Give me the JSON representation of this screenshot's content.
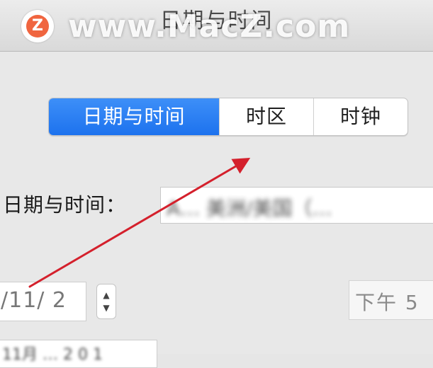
{
  "window": {
    "title": "日期与时间"
  },
  "watermark": {
    "logo_letter": "Z",
    "text": "www.MacZ.com"
  },
  "tabs": [
    {
      "label": "日期与时间",
      "active": true
    },
    {
      "label": "时区",
      "active": false
    },
    {
      "label": "时钟",
      "active": false
    }
  ],
  "form": {
    "date_time_label": "日期与时间：",
    "timezone_value": "A…  美洲/美国（…"
  },
  "date_input": {
    "value": "/11/ 2"
  },
  "time_input": {
    "value": "下午 5"
  },
  "calendar_header": {
    "value": "11月 … 2 0 1"
  },
  "annotation": {
    "arrow_color": "#d4202c"
  },
  "colors": {
    "accent": "#1d72ee",
    "watermark_logo": "#f0653f"
  }
}
